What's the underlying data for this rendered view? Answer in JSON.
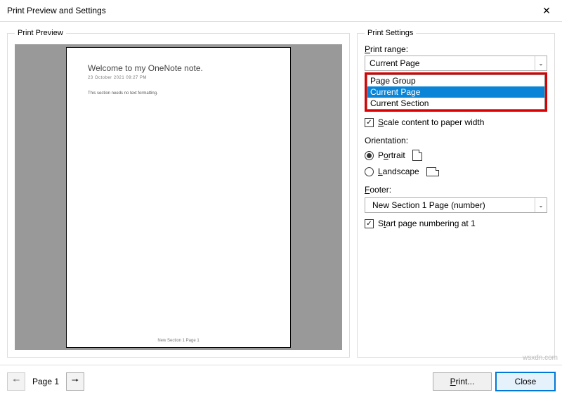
{
  "titlebar": {
    "title": "Print Preview and Settings"
  },
  "preview": {
    "legend": "Print Preview",
    "page_title": "Welcome to my OneNote note.",
    "page_date": "23 October 2021        09:27 PM",
    "page_body": "This section needs no text formatting.",
    "page_footer": "New Section 1 Page 1"
  },
  "settings": {
    "legend": "Print Settings",
    "print_range_label": "Print range:",
    "print_range_value": "Current Page",
    "dropdown": {
      "options": [
        "Page Group",
        "Current Page",
        "Current Section"
      ],
      "selected": "Current Page"
    },
    "scale_label": "Scale content to paper width",
    "scale_checked": true,
    "orientation_label": "Orientation:",
    "portrait_label": "Portrait",
    "landscape_label": "Landscape",
    "orientation_value": "Portrait",
    "footer_label": "Footer:",
    "footer_value": "New Section 1 Page (number)",
    "start_num_label": "Start page numbering at 1",
    "start_num_checked": true
  },
  "bottom": {
    "page_label": "Page 1",
    "print_button": "Print...",
    "close_button": "Close"
  },
  "watermark": "wsxdn.com"
}
